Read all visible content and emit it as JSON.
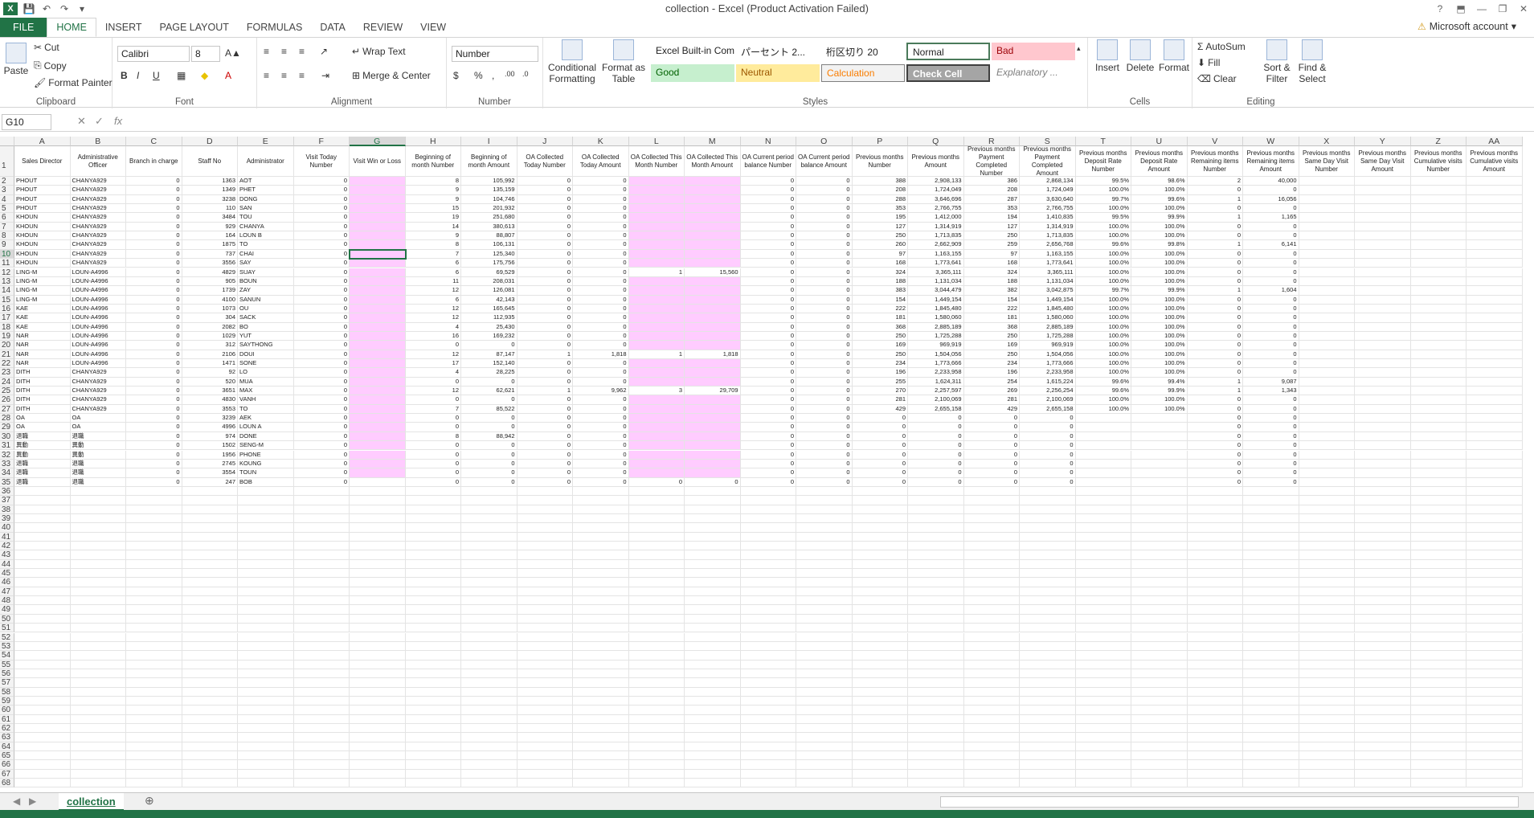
{
  "window": {
    "title": "collection - Excel (Product Activation Failed)"
  },
  "tabs": [
    "FILE",
    "HOME",
    "INSERT",
    "PAGE LAYOUT",
    "FORMULAS",
    "DATA",
    "REVIEW",
    "VIEW"
  ],
  "account": "Microsoft account",
  "ribbon": {
    "clipboard": {
      "paste": "Paste",
      "cut": "Cut",
      "copy": "Copy",
      "format_painter": "Format Painter",
      "label": "Clipboard"
    },
    "font": {
      "name": "Calibri",
      "size": "8",
      "label": "Font"
    },
    "alignment": {
      "wrap": "Wrap Text",
      "merge": "Merge & Center",
      "label": "Alignment"
    },
    "number": {
      "format": "Number",
      "label": "Number"
    },
    "styles": {
      "conditional": "Conditional Formatting",
      "format_table": "Format as Table",
      "builtin": "Excel Built-in Com...",
      "s1": "パーセント 2...",
      "s2": "桁区切り 20",
      "normal": "Normal",
      "bad": "Bad",
      "good": "Good",
      "neutral": "Neutral",
      "calculation": "Calculation",
      "check": "Check Cell",
      "explanatory": "Explanatory ...",
      "label": "Styles"
    },
    "cells": {
      "insert": "Insert",
      "delete": "Delete",
      "format": "Format",
      "label": "Cells"
    },
    "editing": {
      "autosum": "AutoSum",
      "fill": "Fill",
      "clear": "Clear",
      "sort": "Sort & Filter",
      "find": "Find & Select",
      "label": "Editing"
    }
  },
  "formula_bar": {
    "name_box": "G10",
    "value": ""
  },
  "columns": [
    "A",
    "B",
    "C",
    "D",
    "E",
    "F",
    "G",
    "H",
    "I",
    "J",
    "K",
    "L",
    "M",
    "N",
    "O",
    "P",
    "Q",
    "R",
    "S",
    "T",
    "U",
    "V",
    "W",
    "X",
    "Y",
    "Z",
    "AA"
  ],
  "headers": [
    "Sales Director",
    "Administrative Officer",
    "Branch in charge",
    "Staff No",
    "Administrator",
    "Visit Today Number",
    "Visit Win or Loss",
    "Beginning of month Number",
    "Beginning of month Amount",
    "OA Collected Today Number",
    "OA Collected Today Amount",
    "OA Collected This Month Number",
    "OA Collected This Month Amount",
    "OA Current period balance Number",
    "OA Current period balance Amount",
    "Previous months Number",
    "Previous months Amount",
    "Previous months Payment Completed Number",
    "Previous months Payment Completed Amount",
    "Previous months Deposit Rate Number",
    "Previous months Deposit Rate Amount",
    "Previous months Remaining items Number",
    "Previous months Remaining items Amount",
    "Previous months Same Day Visit Number",
    "Previous months Same Day Visit Amount",
    "Previous months Cumulative visits Number",
    "Previous months Cumulative visits Amount"
  ],
  "rows": [
    [
      "PHOUT",
      "CHANYA929",
      "0",
      "1363",
      "AOT",
      "0",
      "",
      "8",
      "105,992",
      "0",
      "0",
      "",
      "",
      "0",
      "0",
      "388",
      "2,908,133",
      "386",
      "2,868,134",
      "99.5%",
      "98.6%",
      "2",
      "40,000"
    ],
    [
      "PHOUT",
      "CHANYA929",
      "0",
      "1349",
      "PHET",
      "0",
      "",
      "9",
      "135,159",
      "0",
      "0",
      "",
      "",
      "0",
      "0",
      "208",
      "1,724,049",
      "208",
      "1,724,049",
      "100.0%",
      "100.0%",
      "0",
      "0"
    ],
    [
      "PHOUT",
      "CHANYA929",
      "0",
      "3238",
      "DONG",
      "0",
      "",
      "9",
      "104,746",
      "0",
      "0",
      "",
      "",
      "0",
      "0",
      "288",
      "3,646,696",
      "287",
      "3,630,640",
      "99.7%",
      "99.6%",
      "1",
      "16,056"
    ],
    [
      "PHOUT",
      "CHANYA929",
      "0",
      "110",
      "SAN",
      "0",
      "",
      "15",
      "201,932",
      "0",
      "0",
      "",
      "",
      "0",
      "0",
      "353",
      "2,766,755",
      "353",
      "2,766,755",
      "100.0%",
      "100.0%",
      "0",
      "0"
    ],
    [
      "KHOUN",
      "CHANYA929",
      "0",
      "3484",
      "TOU",
      "0",
      "",
      "19",
      "251,680",
      "0",
      "0",
      "",
      "",
      "0",
      "0",
      "195",
      "1,412,000",
      "194",
      "1,410,835",
      "99.5%",
      "99.9%",
      "1",
      "1,165"
    ],
    [
      "KHOUN",
      "CHANYA929",
      "0",
      "929",
      "CHANYA",
      "0",
      "",
      "14",
      "380,613",
      "0",
      "0",
      "",
      "",
      "0",
      "0",
      "127",
      "1,314,919",
      "127",
      "1,314,919",
      "100.0%",
      "100.0%",
      "0",
      "0"
    ],
    [
      "KHOUN",
      "CHANYA929",
      "0",
      "164",
      "LOUN B",
      "0",
      "",
      "9",
      "88,807",
      "0",
      "0",
      "",
      "",
      "0",
      "0",
      "250",
      "1,713,835",
      "250",
      "1,713,835",
      "100.0%",
      "100.0%",
      "0",
      "0"
    ],
    [
      "KHOUN",
      "CHANYA929",
      "0",
      "1875",
      "TO",
      "0",
      "",
      "8",
      "106,131",
      "0",
      "0",
      "",
      "",
      "0",
      "0",
      "260",
      "2,662,909",
      "259",
      "2,656,768",
      "99.6%",
      "99.8%",
      "1",
      "6,141"
    ],
    [
      "KHOUN",
      "CHANYA929",
      "0",
      "737",
      "CHAI",
      "0",
      "",
      "7",
      "125,340",
      "0",
      "0",
      "",
      "",
      "0",
      "0",
      "97",
      "1,163,155",
      "97",
      "1,163,155",
      "100.0%",
      "100.0%",
      "0",
      "0"
    ],
    [
      "KHOUN",
      "CHANYA929",
      "0",
      "3556",
      "SAY",
      "0",
      "",
      "6",
      "175,756",
      "0",
      "0",
      "",
      "",
      "0",
      "0",
      "168",
      "1,773,641",
      "168",
      "1,773,641",
      "100.0%",
      "100.0%",
      "0",
      "0"
    ],
    [
      "LING-M",
      "LOUN-A4996",
      "0",
      "4829",
      "SUAY",
      "0",
      "",
      "6",
      "69,529",
      "0",
      "0",
      "1",
      "15,560",
      "0",
      "0",
      "324",
      "3,365,111",
      "324",
      "3,365,111",
      "100.0%",
      "100.0%",
      "0",
      "0"
    ],
    [
      "LING-M",
      "LOUN-A4996",
      "0",
      "905",
      "BOUN",
      "0",
      "",
      "11",
      "208,031",
      "0",
      "0",
      "",
      "",
      "0",
      "0",
      "188",
      "1,131,034",
      "188",
      "1,131,034",
      "100.0%",
      "100.0%",
      "0",
      "0"
    ],
    [
      "LING-M",
      "LOUN-A4996",
      "0",
      "1739",
      "ZAY",
      "0",
      "",
      "12",
      "126,081",
      "0",
      "0",
      "",
      "",
      "0",
      "0",
      "383",
      "3,044,479",
      "382",
      "3,042,875",
      "99.7%",
      "99.9%",
      "1",
      "1,604"
    ],
    [
      "LING-M",
      "LOUN-A4996",
      "0",
      "4100",
      "SANUN",
      "0",
      "",
      "6",
      "42,143",
      "0",
      "0",
      "",
      "",
      "0",
      "0",
      "154",
      "1,449,154",
      "154",
      "1,449,154",
      "100.0%",
      "100.0%",
      "0",
      "0"
    ],
    [
      "KAE",
      "LOUN-A4996",
      "0",
      "1073",
      "OU",
      "0",
      "",
      "12",
      "165,645",
      "0",
      "0",
      "",
      "",
      "0",
      "0",
      "222",
      "1,845,480",
      "222",
      "1,845,480",
      "100.0%",
      "100.0%",
      "0",
      "0"
    ],
    [
      "KAE",
      "LOUN-A4996",
      "0",
      "304",
      "SACK",
      "0",
      "",
      "12",
      "112,935",
      "0",
      "0",
      "",
      "",
      "0",
      "0",
      "181",
      "1,580,060",
      "181",
      "1,580,060",
      "100.0%",
      "100.0%",
      "0",
      "0"
    ],
    [
      "KAE",
      "LOUN-A4996",
      "0",
      "2082",
      "BO",
      "0",
      "",
      "4",
      "25,430",
      "0",
      "0",
      "",
      "",
      "0",
      "0",
      "368",
      "2,885,189",
      "368",
      "2,885,189",
      "100.0%",
      "100.0%",
      "0",
      "0"
    ],
    [
      "NAR",
      "LOUN-A4996",
      "0",
      "1029",
      "YUT",
      "0",
      "",
      "16",
      "169,232",
      "0",
      "0",
      "",
      "",
      "0",
      "0",
      "250",
      "1,725,288",
      "250",
      "1,725,288",
      "100.0%",
      "100.0%",
      "0",
      "0"
    ],
    [
      "NAR",
      "LOUN-A4996",
      "0",
      "312",
      "SAYTHONG",
      "0",
      "",
      "0",
      "0",
      "0",
      "0",
      "",
      "",
      "0",
      "0",
      "169",
      "969,919",
      "169",
      "969,919",
      "100.0%",
      "100.0%",
      "0",
      "0"
    ],
    [
      "NAR",
      "LOUN-A4996",
      "0",
      "2106",
      "DOUI",
      "0",
      "",
      "12",
      "87,147",
      "1",
      "1,818",
      "1",
      "1,818",
      "0",
      "0",
      "250",
      "1,504,056",
      "250",
      "1,504,056",
      "100.0%",
      "100.0%",
      "0",
      "0"
    ],
    [
      "NAR",
      "LOUN-A4996",
      "0",
      "1471",
      "SONE",
      "0",
      "",
      "17",
      "152,140",
      "0",
      "0",
      "",
      "",
      "0",
      "0",
      "234",
      "1,773,666",
      "234",
      "1,773,666",
      "100.0%",
      "100.0%",
      "0",
      "0"
    ],
    [
      "DITH",
      "CHANYA929",
      "0",
      "92",
      "LO",
      "0",
      "",
      "4",
      "28,225",
      "0",
      "0",
      "",
      "",
      "0",
      "0",
      "196",
      "2,233,958",
      "196",
      "2,233,958",
      "100.0%",
      "100.0%",
      "0",
      "0"
    ],
    [
      "DITH",
      "CHANYA929",
      "0",
      "520",
      "MUA",
      "0",
      "",
      "0",
      "0",
      "0",
      "0",
      "",
      "",
      "0",
      "0",
      "255",
      "1,624,311",
      "254",
      "1,615,224",
      "99.6%",
      "99.4%",
      "1",
      "9,087"
    ],
    [
      "DITH",
      "CHANYA929",
      "0",
      "3651",
      "MAX",
      "0",
      "",
      "12",
      "62,621",
      "1",
      "9,962",
      "3",
      "29,709",
      "0",
      "0",
      "270",
      "2,257,597",
      "269",
      "2,256,254",
      "99.6%",
      "99.9%",
      "1",
      "1,343"
    ],
    [
      "DITH",
      "CHANYA929",
      "0",
      "4830",
      "VANH",
      "0",
      "",
      "0",
      "0",
      "0",
      "0",
      "",
      "",
      "0",
      "0",
      "281",
      "2,100,069",
      "281",
      "2,100,069",
      "100.0%",
      "100.0%",
      "0",
      "0"
    ],
    [
      "DITH",
      "CHANYA929",
      "0",
      "3553",
      "TO",
      "0",
      "",
      "7",
      "85,522",
      "0",
      "0",
      "",
      "",
      "0",
      "0",
      "429",
      "2,655,158",
      "429",
      "2,655,158",
      "100.0%",
      "100.0%",
      "0",
      "0"
    ],
    [
      "OA",
      "OA",
      "0",
      "3239",
      "AEK",
      "0",
      "",
      "0",
      "0",
      "0",
      "0",
      "",
      "",
      "0",
      "0",
      "0",
      "0",
      "0",
      "0",
      "",
      "",
      "0",
      "0"
    ],
    [
      "OA",
      "OA",
      "0",
      "4996",
      "LOUN A",
      "0",
      "",
      "0",
      "0",
      "0",
      "0",
      "",
      "",
      "0",
      "0",
      "0",
      "0",
      "0",
      "0",
      "",
      "",
      "0",
      "0"
    ],
    [
      "退職",
      "退職",
      "0",
      "974",
      "DONE",
      "0",
      "",
      "8",
      "88,942",
      "0",
      "0",
      "",
      "",
      "0",
      "0",
      "0",
      "0",
      "0",
      "0",
      "",
      "",
      "0",
      "0"
    ],
    [
      "異動",
      "異動",
      "0",
      "1502",
      "SENG-M",
      "0",
      "",
      "0",
      "0",
      "0",
      "0",
      "",
      "",
      "0",
      "0",
      "0",
      "0",
      "0",
      "0",
      "",
      "",
      "0",
      "0"
    ],
    [
      "異動",
      "異動",
      "0",
      "1956",
      "PHONE",
      "0",
      "",
      "0",
      "0",
      "0",
      "0",
      "",
      "",
      "0",
      "0",
      "0",
      "0",
      "0",
      "0",
      "",
      "",
      "0",
      "0"
    ],
    [
      "退職",
      "退職",
      "0",
      "2745",
      "KOUNG",
      "0",
      "",
      "0",
      "0",
      "0",
      "0",
      "",
      "",
      "0",
      "0",
      "0",
      "0",
      "0",
      "0",
      "",
      "",
      "0",
      "0"
    ],
    [
      "退職",
      "退職",
      "0",
      "3554",
      "TOUN",
      "0",
      "",
      "0",
      "0",
      "0",
      "0",
      "",
      "",
      "0",
      "0",
      "0",
      "0",
      "0",
      "0",
      "",
      "",
      "0",
      "0"
    ],
    [
      "退職",
      "退職",
      "0",
      "247",
      "BOB",
      "0",
      "",
      "0",
      "0",
      "0",
      "0",
      "0",
      "0",
      "0",
      "0",
      "0",
      "0",
      "0",
      "0",
      "",
      "",
      "0",
      "0"
    ]
  ],
  "sheet_tab": "collection"
}
